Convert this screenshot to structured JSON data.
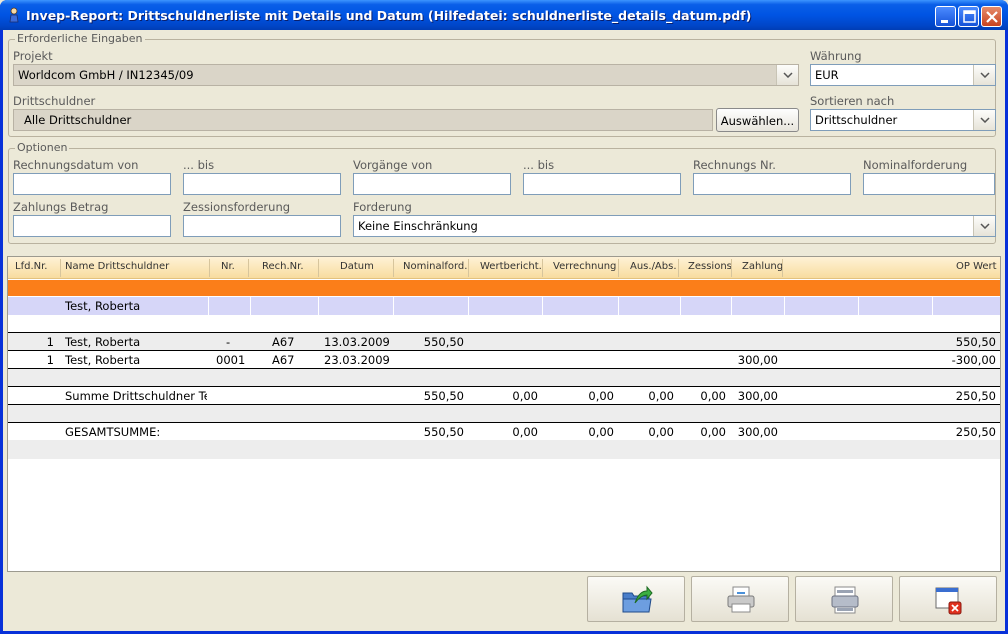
{
  "window": {
    "title": "Invep-Report: Drittschuldnerliste mit Details und Datum    (Hilfedatei: schuldnerliste_details_datum.pdf)"
  },
  "required": {
    "legend": "Erforderliche Eingaben",
    "projekt_label": "Projekt",
    "projekt_value": "Worldcom GmbH / IN12345/09",
    "waehrung_label": "Währung",
    "waehrung_value": "EUR",
    "drittschuldner_label": "Drittschuldner",
    "drittschuldner_value": "Alle Drittschuldner",
    "select_button": "Auswählen...",
    "sort_label": "Sortieren nach",
    "sort_value": "Drittschuldner"
  },
  "options": {
    "legend": "Optionen",
    "rechnungsdatum_von": "Rechnungsdatum von",
    "bis1": "... bis",
    "vorgaenge_von": "Vorgänge von",
    "bis2": "... bis",
    "rechnungs_nr": "Rechnungs Nr.",
    "nominalforderung": "Nominalforderung",
    "zahlungs_betrag": "Zahlungs Betrag",
    "zessionsforderung": "Zessionsforderung",
    "forderung": "Forderung",
    "forderung_value": "Keine Einschränkung"
  },
  "table": {
    "columns": [
      "Lfd.Nr.",
      "Name Drittschuldner",
      "Nr.",
      "Rech.Nr.",
      "Datum",
      "Nominalford.",
      "Wertbericht.",
      "Verrechnung",
      "Aus./Abs.",
      "Zessions",
      "Zahlung",
      "OP Wert"
    ],
    "group_name": "Test, Roberta",
    "rows": [
      {
        "lfd": "1",
        "name": "Test, Roberta",
        "nr": "-",
        "rech": "A67",
        "datum": "13.03.2009",
        "nominal": "550,50",
        "wert": "",
        "verr": "",
        "aus": "",
        "zess": "",
        "zahlung": "",
        "op": "550,50"
      },
      {
        "lfd": "1",
        "name": "Test, Roberta",
        "nr": "0001",
        "rech": "A67",
        "datum": "23.03.2009",
        "nominal": "",
        "wert": "",
        "verr": "",
        "aus": "",
        "zess": "",
        "zahlung": "300,00",
        "op": "-300,00"
      }
    ],
    "summe": {
      "label": "Summe Drittschuldner Test, Roberta",
      "nominal": "550,50",
      "wert": "0,00",
      "verr": "0,00",
      "aus": "0,00",
      "zess": "0,00",
      "zahlung": "300,00",
      "op": "250,50"
    },
    "gesamt": {
      "label": "GESAMTSUMME:",
      "nominal": "550,50",
      "wert": "0,00",
      "verr": "0,00",
      "aus": "0,00",
      "zess": "0,00",
      "zahlung": "300,00",
      "op": "250,50"
    }
  },
  "icons": {
    "export": "folder-export-icon",
    "print": "printer-icon",
    "preview": "print-preview-icon",
    "close": "close-window-icon"
  },
  "colors": {
    "titlebar": "#0054e3",
    "header": "#f8dc9f",
    "orange_band": "#fb7e19",
    "group_row": "#d6d6f8"
  }
}
